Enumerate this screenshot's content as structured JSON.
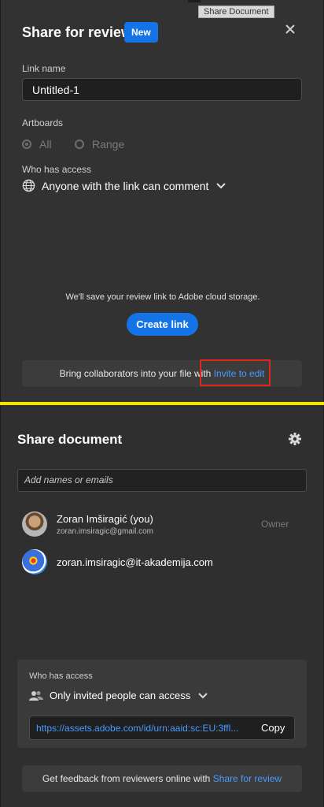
{
  "tooltip": "Share Document",
  "review": {
    "title": "Share for review",
    "badge": "New",
    "link_name_label": "Link name",
    "link_name_value": "Untitled-1",
    "artboards_label": "Artboards",
    "artboards_options": [
      "All",
      "Range"
    ],
    "artboards_selected": "All",
    "who_label": "Who has access",
    "who_value": "Anyone with the link can comment",
    "save_note": "We'll save your review link to Adobe cloud storage.",
    "create_label": "Create link",
    "collab_text": "Bring collaborators into your file with",
    "collab_link": "Invite to edit"
  },
  "share": {
    "title": "Share document",
    "names_placeholder": "Add names or emails",
    "people": [
      {
        "name": "Zoran Imširagić (you)",
        "email": "zoran.imsiragic@gmail.com",
        "role": "Owner"
      },
      {
        "name": "zoran.imsiragic@it-akademija.com",
        "email": "",
        "role": ""
      }
    ],
    "who_label": "Who has access",
    "who_value": "Only invited people can access",
    "url": "https://assets.adobe.com/id/urn:aaid:sc:EU:3ffl...",
    "copy_label": "Copy",
    "feedback_text": "Get feedback from reviewers online with",
    "feedback_link": "Share for review"
  },
  "colors": {
    "accent": "#1473e6",
    "link": "#4a9bff",
    "highlight": "#e0261b",
    "divider": "#f2e600"
  }
}
